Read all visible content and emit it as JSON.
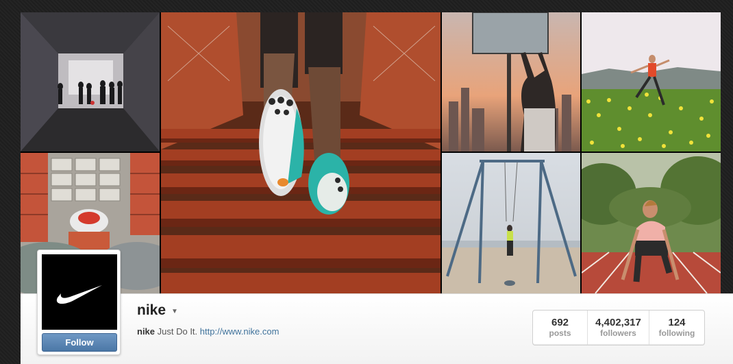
{
  "profile": {
    "username": "nike",
    "bio_name": "nike",
    "bio_text": "Just Do It.",
    "website": "http://www.nike.com",
    "follow_label": "Follow",
    "avatar_logo": "swoosh-icon"
  },
  "stats": [
    {
      "value": "692",
      "label": "posts"
    },
    {
      "value": "4,402,317",
      "label": "followers"
    },
    {
      "value": "124",
      "label": "following"
    }
  ],
  "mosaic": {
    "tiles": [
      "tunnel-soccer-photo",
      "shoe-boxes-photo",
      "runner-stairs-photo",
      "basketball-sunset-photo",
      "field-jump-photo",
      "beach-swing-photo",
      "track-start-photo"
    ]
  },
  "colors": {
    "accent": "#3f729b",
    "follow_button": "#5a85b3",
    "background": "#222222"
  }
}
